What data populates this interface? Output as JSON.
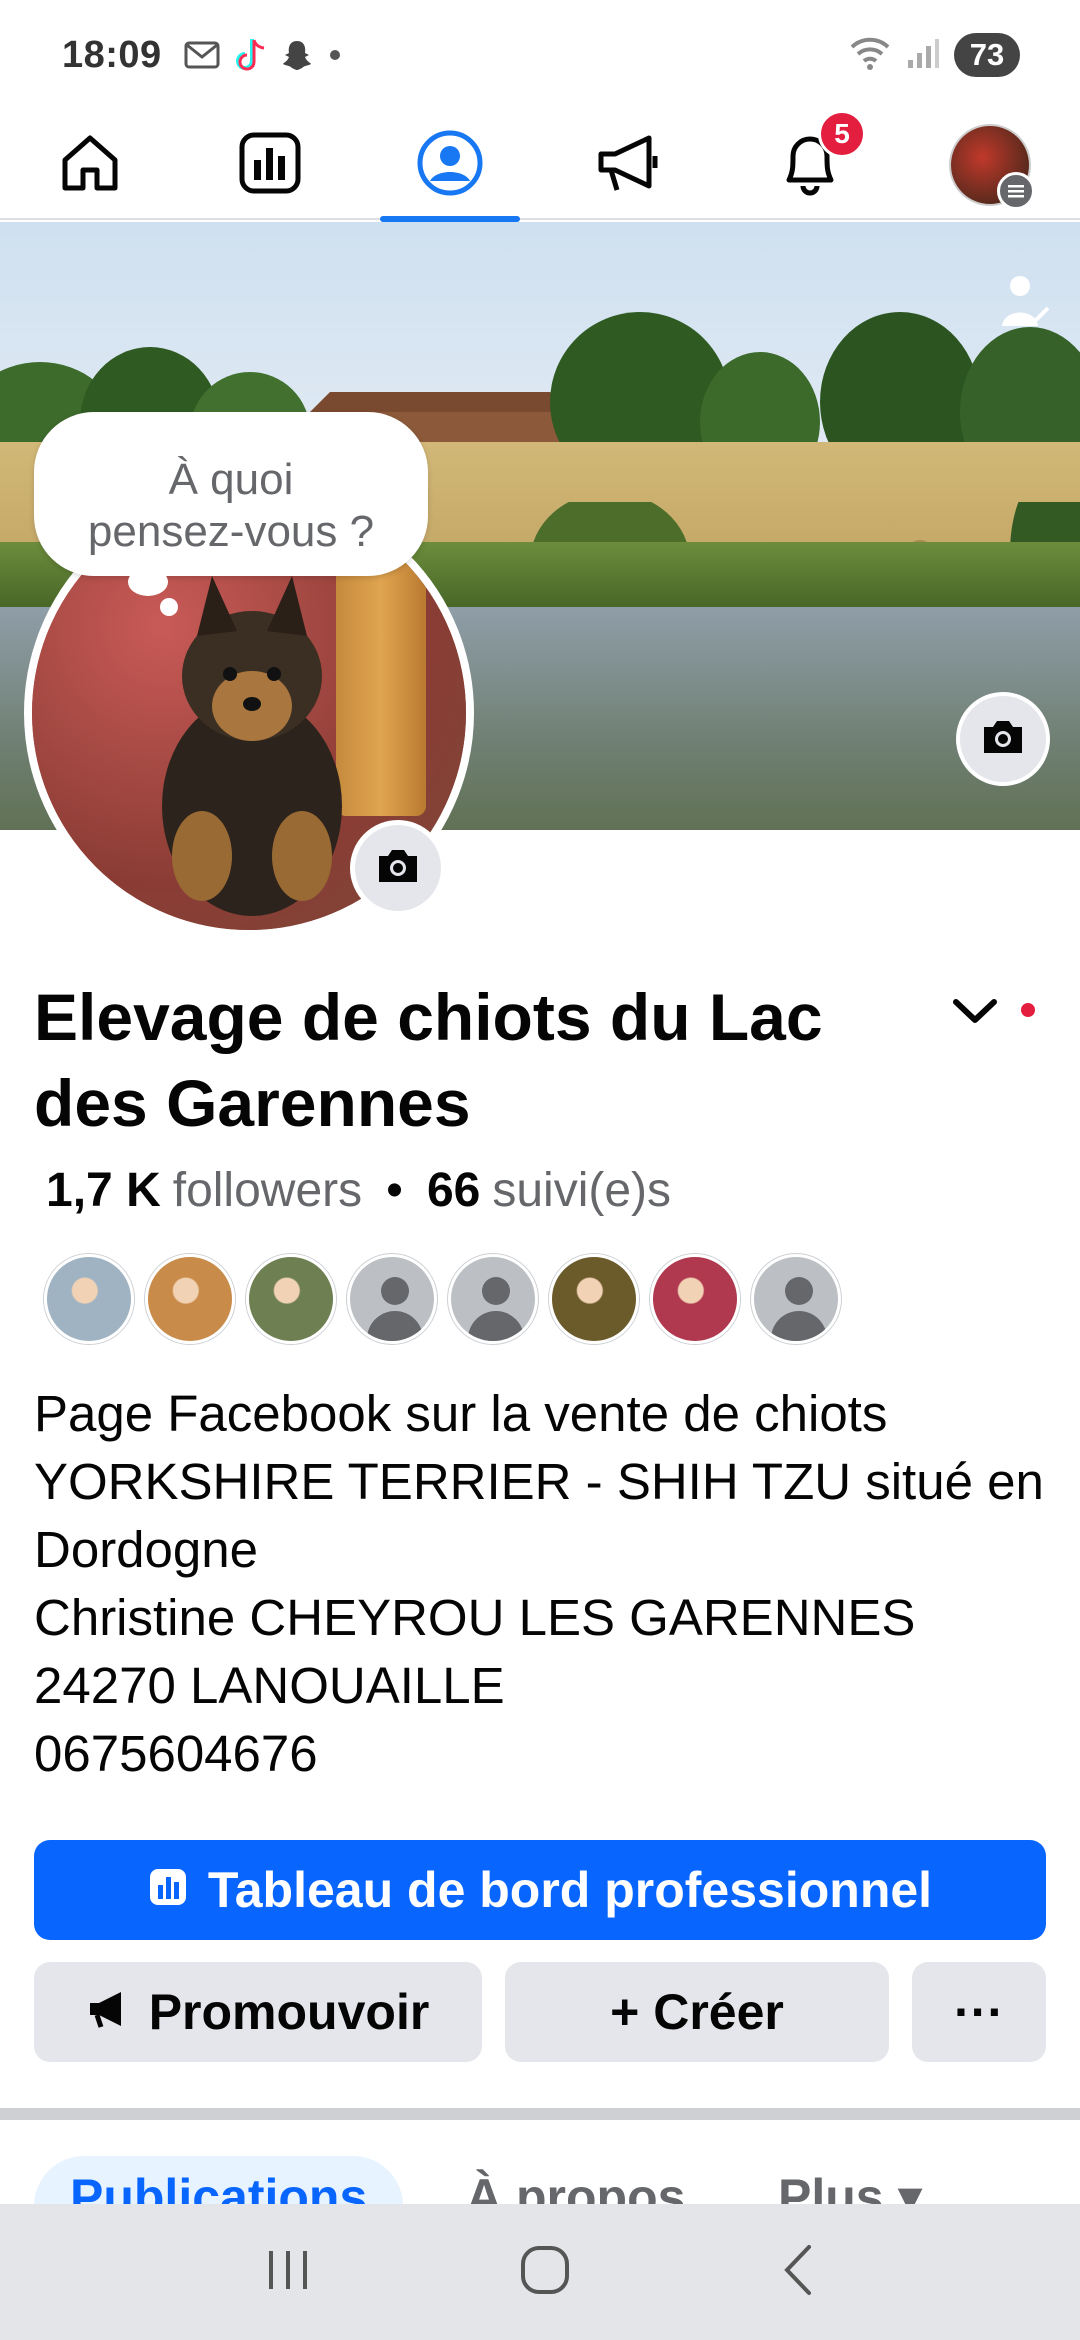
{
  "status_bar": {
    "time": "18:09",
    "battery": "73",
    "icons": [
      "mail-icon",
      "tiktok-icon",
      "snapchat-icon",
      "dot-icon",
      "wifi-icon",
      "signal-icon"
    ]
  },
  "top_nav": {
    "items": [
      "home-icon",
      "insights-icon",
      "profile-icon",
      "megaphone-icon",
      "bell-icon",
      "avatar"
    ],
    "active": "profile-icon",
    "notification_count": "5"
  },
  "composer_bubble": {
    "text": "À quoi pensez-vous ?"
  },
  "profile": {
    "name": "Elevage de chiots du Lac des Garennes",
    "followers_count": "1,7 K",
    "followers_label": "followers",
    "following_count": "66",
    "following_label": "suivi(e)s",
    "bio": "Page Facebook sur la vente de chiots\n YORKSHIRE TERRIER - SHIH TZU situé en Dordogne\nChristine CHEYROU LES GARENNES\n24270 LANOUAILLE\n0675604676"
  },
  "friends": [
    {
      "type": "photo",
      "color": "#9fb3c2"
    },
    {
      "type": "photo",
      "color": "#c98b4a"
    },
    {
      "type": "photo",
      "color": "#6e7f52"
    },
    {
      "type": "placeholder"
    },
    {
      "type": "placeholder"
    },
    {
      "type": "photo",
      "color": "#6b5a2a"
    },
    {
      "type": "photo",
      "color": "#b0384f"
    },
    {
      "type": "placeholder"
    }
  ],
  "actions": {
    "dashboard_label": "Tableau de bord professionnel",
    "promote_label": "Promouvoir",
    "create_label": "+ Créer",
    "more_label": "···"
  },
  "tabs": {
    "posts": "Publications",
    "about": "À propos",
    "more": "Plus ▾"
  },
  "colors": {
    "accent": "#0866ff",
    "notification": "#e41e3f",
    "button_gray": "#e4e6eb"
  }
}
